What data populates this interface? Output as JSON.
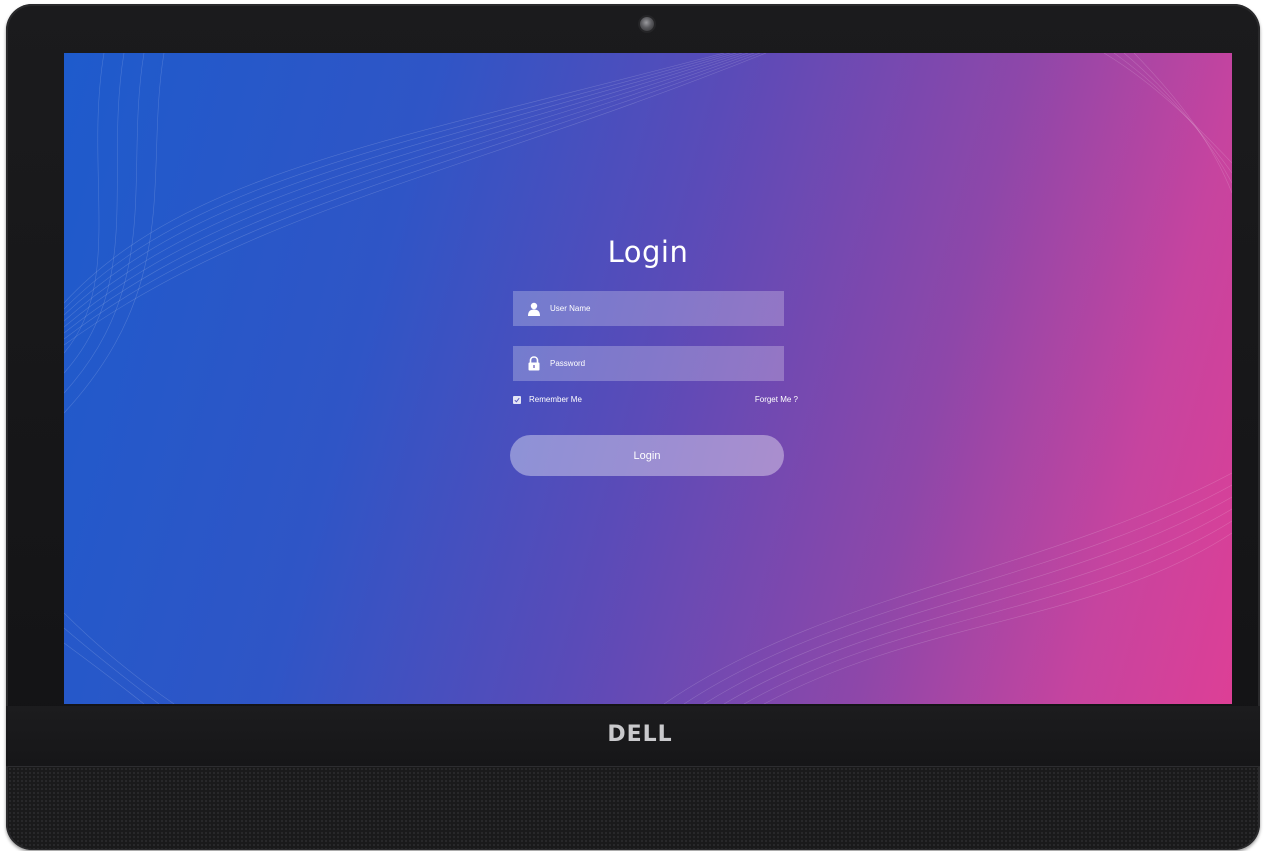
{
  "device": {
    "brand": "DELL"
  },
  "login": {
    "title": "Login",
    "username_placeholder": "User Name",
    "password_placeholder": "Password",
    "remember_label": "Remember Me",
    "remember_checked": true,
    "forget_link": "Forget Me ?",
    "submit_label": "Login"
  },
  "icons": {
    "username": "user-icon",
    "password": "lock-icon",
    "remember": "checkbox-checked-icon"
  },
  "colors": {
    "gradient_start": "#1e5bcc",
    "gradient_mid": "#5a4bb8",
    "gradient_end": "#dd3f96",
    "text": "#ffffff"
  }
}
